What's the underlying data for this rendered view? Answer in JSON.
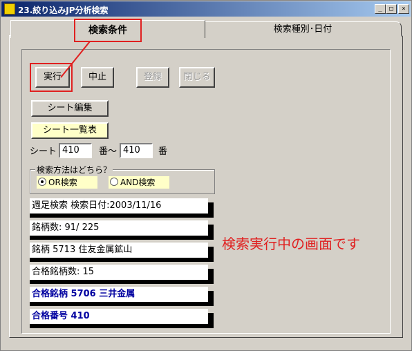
{
  "window": {
    "title": "23.絞り込みJP分析検索",
    "minimize": "_",
    "maximize": "□",
    "close": "×"
  },
  "tabs": [
    {
      "label": "検索条件"
    },
    {
      "label": "検索種別･日付"
    }
  ],
  "buttons": {
    "run": "実行",
    "stop": "中止",
    "register": "登録",
    "close": "閉じる",
    "edit_sheet": "シート編集",
    "sheet_list": "シート一覧表"
  },
  "sheet_range": {
    "label": "シート",
    "from": "410",
    "separator": "番〜",
    "to": "410",
    "suffix": "番"
  },
  "search_method": {
    "title": "検索方法はどちら？",
    "options": [
      "OR検索",
      "AND検索"
    ],
    "selected": "OR検索"
  },
  "status": [
    "週足検索  検索日付:2003/11/16",
    "銘柄数: 91/ 225",
    "銘柄 5713 住友金属鉱山",
    "合格銘柄数: 15",
    "合格銘柄 5706 三井金属",
    "合格番号 410"
  ],
  "annotation": "検索実行中の画面です",
  "colors": {
    "annotation": "#e02020",
    "highlight": "#0000a0",
    "field_bg": "#ffffc8"
  }
}
